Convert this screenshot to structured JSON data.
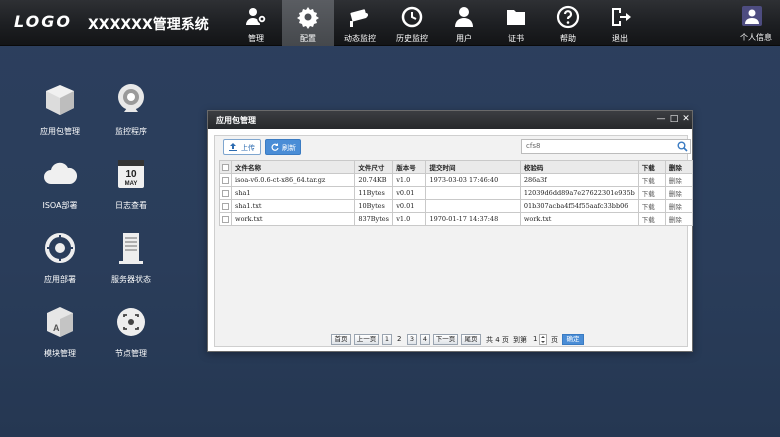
{
  "header": {
    "logo": "LOGO",
    "system_name": "XXXXXX管理系统",
    "nav": [
      {
        "label": "管理",
        "icon": "user-gear-icon",
        "active": false
      },
      {
        "label": "配置",
        "icon": "gear-icon",
        "active": true
      },
      {
        "label": "动态监控",
        "icon": "camera-icon",
        "active": false
      },
      {
        "label": "历史监控",
        "icon": "history-icon",
        "active": false
      },
      {
        "label": "用户",
        "icon": "user-icon",
        "active": false
      },
      {
        "label": "证书",
        "icon": "folder-icon",
        "active": false
      },
      {
        "label": "帮助",
        "icon": "help-icon",
        "active": false
      },
      {
        "label": "退出",
        "icon": "logout-icon",
        "active": false
      }
    ],
    "profile_label": "个人信息"
  },
  "desktop": [
    {
      "label": "应用包管理",
      "icon": "package-icon"
    },
    {
      "label": "监控程序",
      "icon": "webcam-icon"
    },
    {
      "label": "ISOA部署",
      "icon": "cloud-icon"
    },
    {
      "label": "日志查看",
      "icon": "calendar-icon"
    },
    {
      "label": "应用部署",
      "icon": "deploy-icon"
    },
    {
      "label": "服务器状态",
      "icon": "server-icon"
    },
    {
      "label": "模块管理",
      "icon": "module-icon"
    },
    {
      "label": "节点管理",
      "icon": "node-icon"
    }
  ],
  "calendar_icon": {
    "day": "10",
    "month": "MAY"
  },
  "window": {
    "title": "应用包管理",
    "upload_label": "上传",
    "refresh_label": "刷新",
    "search_value": "cfs8",
    "columns": [
      "文件名称",
      "文件尺寸",
      "版本号",
      "提交时间",
      "校验码",
      "下载",
      "删除"
    ],
    "rows": [
      {
        "name": "isoa-v6.0.6-ct-x86_64.tar.gz",
        "size": "20.74KB",
        "version": "v1.0",
        "time": "1973-03-03 17:46:40",
        "checksum": "286a3f",
        "download": "下载",
        "delete": "删除"
      },
      {
        "name": "sha1",
        "size": "11Bytes",
        "version": "v0.01",
        "time": "",
        "checksum": "12039d6dd89a7e27622301e935b",
        "download": "下载",
        "delete": "删除"
      },
      {
        "name": "sha1.txt",
        "size": "10Bytes",
        "version": "v0.01",
        "time": "",
        "checksum": "01b307acba4f54f55aafc33bb06",
        "download": "下载",
        "delete": "删除"
      },
      {
        "name": "work.txt",
        "size": "837Bytes",
        "version": "v1.0",
        "time": "1970-01-17 14:37:48",
        "checksum": "work.txt",
        "download": "下载",
        "delete": "删除"
      }
    ],
    "pager": {
      "first": "首页",
      "prev": "上一页",
      "pages": [
        "1",
        "2",
        "3",
        "4"
      ],
      "next": "下一页",
      "last": "尾页",
      "total_text": "共 4 页",
      "goto_text": "到第",
      "goto_value": "1",
      "page_unit": "页",
      "ok": "确定"
    }
  },
  "colors": {
    "accent": "#4a8dd6",
    "topbar": "#1d1f22",
    "background": "#2c3f5e"
  }
}
